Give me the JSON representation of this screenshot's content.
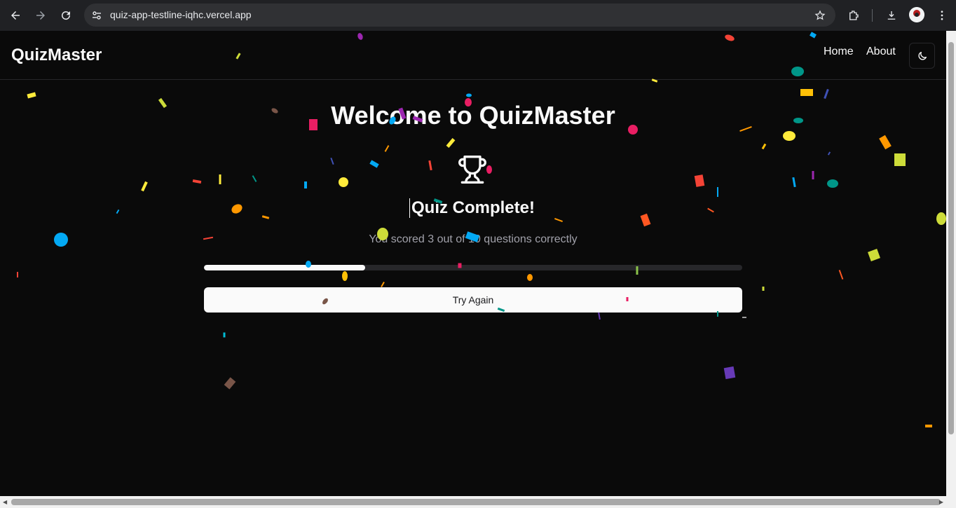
{
  "browser": {
    "url": "quiz-app-testline-iqhc.vercel.app"
  },
  "header": {
    "brand": "QuizMaster",
    "nav": {
      "home": "Home",
      "about": "About"
    },
    "theme_icon": "moon-icon"
  },
  "main": {
    "title": "Welcome to QuizMaster",
    "trophy_icon": "trophy-icon",
    "heading": "Quiz Complete!",
    "score_text": "You scored 3 out of 10 questions correctly",
    "score": 3,
    "total": 10,
    "progress": 0.3,
    "try_again_label": "Try Again"
  },
  "colors": {
    "background": "#0a0a0a",
    "text": "#fafafa",
    "muted": "#a1a1aa",
    "border": "#27272a"
  }
}
